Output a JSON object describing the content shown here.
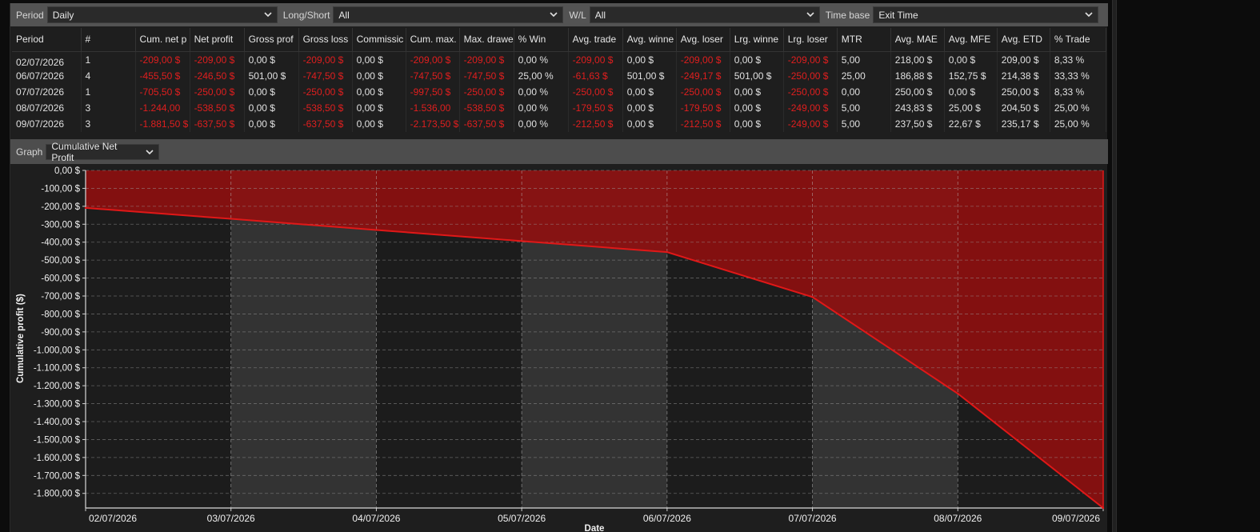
{
  "filters": {
    "period_label": "Period",
    "period_value": "Daily",
    "longshort_label": "Long/Short",
    "longshort_value": "All",
    "wl_label": "W/L",
    "wl_value": "All",
    "timebase_label": "Time base",
    "timebase_value": "Exit Time"
  },
  "table": {
    "columns": [
      "Period",
      "#",
      "Cum. net p",
      "Net profit",
      "Gross prof",
      "Gross loss",
      "Commissic",
      "Cum. max.",
      "Max. drawe",
      "% Win",
      "Avg. trade",
      "Avg. winne",
      "Avg. loser",
      "Lrg. winne",
      "Lrg. loser",
      "MTR",
      "Avg. MAE",
      "Avg. MFE",
      "Avg. ETD",
      "% Trade"
    ],
    "rows": [
      [
        "02/07/2026",
        "1",
        "-209,00 $",
        "-209,00 $",
        "0,00 $",
        "-209,00 $",
        "0,00 $",
        "-209,00 $",
        "-209,00 $",
        "0,00 %",
        "-209,00 $",
        "0,00 $",
        "-209,00 $",
        "0,00 $",
        "-209,00 $",
        "5,00",
        "218,00 $",
        "0,00 $",
        "209,00 $",
        "8,33 %"
      ],
      [
        "06/07/2026",
        "4",
        "-455,50 $",
        "-246,50 $",
        "501,00 $",
        "-747,50 $",
        "0,00 $",
        "-747,50 $",
        "-747,50 $",
        "25,00 %",
        "-61,63 $",
        "501,00 $",
        "-249,17 $",
        "501,00 $",
        "-250,00 $",
        "25,00",
        "186,88 $",
        "152,75 $",
        "214,38 $",
        "33,33 %"
      ],
      [
        "07/07/2026",
        "1",
        "-705,50 $",
        "-250,00 $",
        "0,00 $",
        "-250,00 $",
        "0,00 $",
        "-997,50 $",
        "-250,00 $",
        "0,00 %",
        "-250,00 $",
        "0,00 $",
        "-250,00 $",
        "0,00 $",
        "-250,00 $",
        "0,00",
        "250,00 $",
        "0,00 $",
        "250,00 $",
        "8,33 %"
      ],
      [
        "08/07/2026",
        "3",
        "-1.244,00",
        "-538,50 $",
        "0,00 $",
        "-538,50 $",
        "0,00 $",
        "-1.536,00",
        "-538,50 $",
        "0,00 %",
        "-179,50 $",
        "0,00 $",
        "-179,50 $",
        "0,00 $",
        "-249,00 $",
        "5,00",
        "243,83 $",
        "25,00 $",
        "204,50 $",
        "25,00 %"
      ],
      [
        "09/07/2026",
        "3",
        "-1.881,50 $",
        "-637,50 $",
        "0,00 $",
        "-637,50 $",
        "0,00 $",
        "-2.173,50 $",
        "-637,50 $",
        "0,00 %",
        "-212,50 $",
        "0,00 $",
        "-212,50 $",
        "0,00 $",
        "-249,00 $",
        "5,00",
        "237,50 $",
        "22,67 $",
        "235,17 $",
        "25,00 %"
      ]
    ]
  },
  "graph": {
    "label": "Graph",
    "value": "Cumulative Net Profit"
  },
  "colors": {
    "negative": "#e01e1e",
    "area_fill": "#8f1010",
    "line": "#e01818"
  },
  "chart_data": {
    "type": "area",
    "x": [
      "02/07/2026",
      "03/07/2026",
      "04/07/2026",
      "05/07/2026",
      "06/07/2026",
      "07/07/2026",
      "08/07/2026",
      "09/07/2026"
    ],
    "series": [
      {
        "values": [
          -209,
          -270,
          -332,
          -394,
          -455.5,
          -705.5,
          -1244,
          -1881.5
        ]
      }
    ],
    "yticks": [
      "0,00 $",
      "-100,00 $",
      "-200,00 $",
      "-300,00 $",
      "-400,00 $",
      "-500,00 $",
      "-600,00 $",
      "-700,00 $",
      "-800,00 $",
      "-900,00 $",
      "-1.000,00 $",
      "-1.100,00 $",
      "-1.200,00 $",
      "-1.300,00 $",
      "-1.400,00 $",
      "-1.500,00 $",
      "-1.600,00 $",
      "-1.700,00 $",
      "-1.800,00 $"
    ],
    "ylim": [
      -1881.5,
      0
    ],
    "xlabel": "Date",
    "ylabel": "Cumulative profit ($)",
    "grid": true
  }
}
